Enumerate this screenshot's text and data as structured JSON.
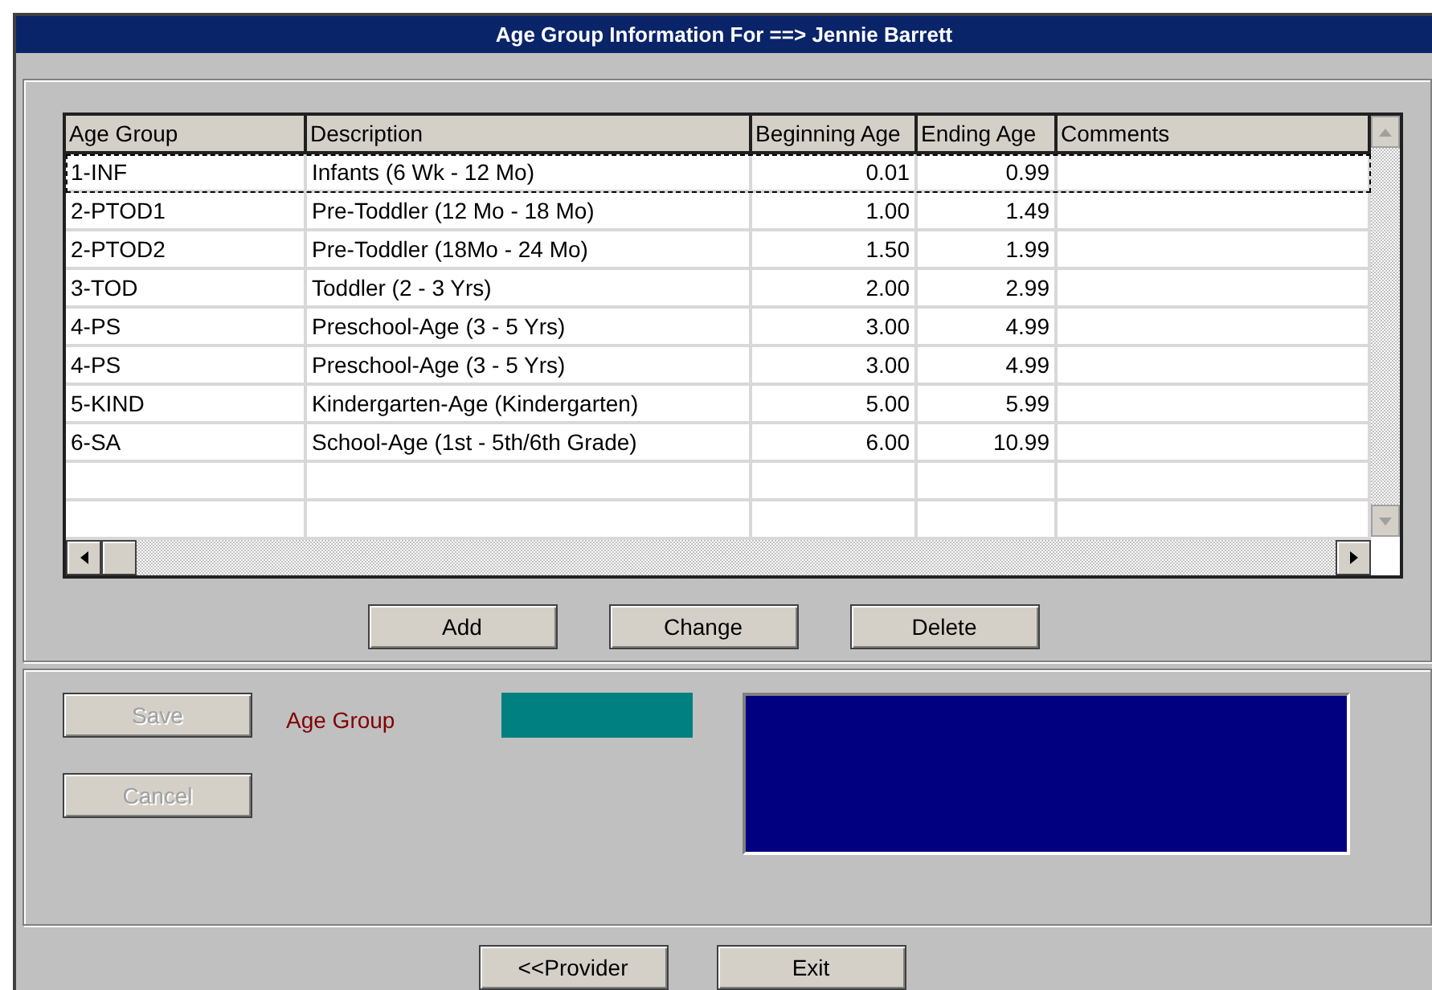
{
  "window": {
    "title": "Age Group Information For ==> Jennie Barrett"
  },
  "table": {
    "columns": [
      "Age Group",
      "Description",
      "Beginning Age",
      "Ending Age",
      "Comments"
    ],
    "rows": [
      {
        "cells": [
          "1-INF",
          "Infants (6 Wk - 12 Mo)",
          "0.01",
          "0.99",
          ""
        ],
        "selected": true
      },
      {
        "cells": [
          "2-PTOD1",
          "Pre-Toddler (12 Mo - 18 Mo)",
          "1.00",
          "1.49",
          ""
        ],
        "selected": false
      },
      {
        "cells": [
          "2-PTOD2",
          "Pre-Toddler (18Mo - 24 Mo)",
          "1.50",
          "1.99",
          ""
        ],
        "selected": false
      },
      {
        "cells": [
          "3-TOD",
          "Toddler (2 - 3 Yrs)",
          "2.00",
          "2.99",
          ""
        ],
        "selected": false
      },
      {
        "cells": [
          "4-PS",
          "Preschool-Age (3 - 5 Yrs)",
          "3.00",
          "4.99",
          ""
        ],
        "selected": false
      },
      {
        "cells": [
          "4-PS",
          "Preschool-Age (3 - 5 Yrs)",
          "3.00",
          "4.99",
          ""
        ],
        "selected": false
      },
      {
        "cells": [
          "5-KIND",
          "Kindergarten-Age (Kindergarten)",
          "5.00",
          "5.99",
          ""
        ],
        "selected": false
      },
      {
        "cells": [
          "6-SA",
          "School-Age (1st - 5th/6th Grade)",
          "6.00",
          "10.99",
          ""
        ],
        "selected": false
      }
    ]
  },
  "list_buttons": [
    {
      "label": "Add"
    },
    {
      "label": "Change"
    },
    {
      "label": "Delete"
    }
  ],
  "edit_panel": {
    "buttons": [
      {
        "label": "Save",
        "disabled": true
      },
      {
        "label": "Cancel",
        "disabled": true
      }
    ],
    "field_label": "Age Group"
  },
  "footer_buttons": [
    {
      "label": "<<Provider"
    },
    {
      "label": "Exit"
    }
  ]
}
